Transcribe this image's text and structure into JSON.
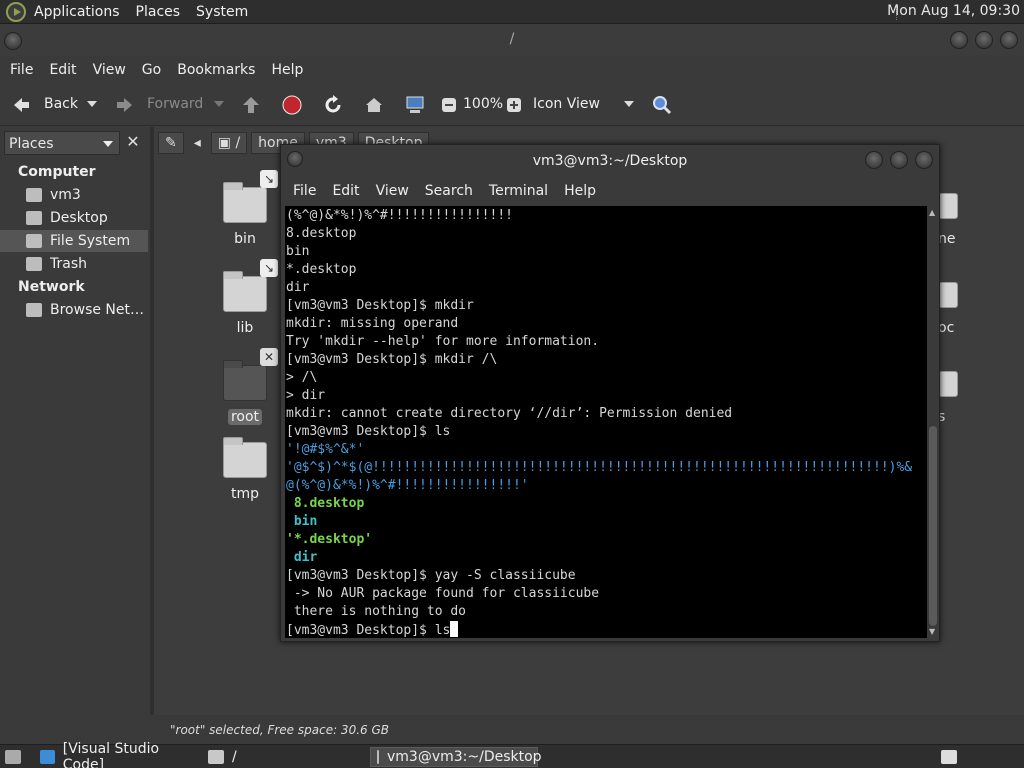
{
  "top_panel": {
    "menus": [
      "Applications",
      "Places",
      "System"
    ],
    "clock": "Mon Aug 14, 09:30"
  },
  "file_manager": {
    "title": "/",
    "menus": [
      "File",
      "Edit",
      "View",
      "Go",
      "Bookmarks",
      "Help"
    ],
    "toolbar": {
      "back": "Back",
      "forward": "Forward",
      "zoom": "100%",
      "view_mode": "Icon View"
    },
    "sidebar": {
      "selector": "Places",
      "sections": [
        {
          "title": "Computer",
          "items": [
            "vm3",
            "Desktop",
            "File System",
            "Trash"
          ]
        },
        {
          "title": "Network",
          "items": [
            "Browse Net…"
          ]
        }
      ],
      "selected": "File System"
    },
    "pathbar": [
      "/",
      "home",
      "vm3",
      "Desktop"
    ],
    "folders": [
      {
        "name": "bin",
        "emblem": "link"
      },
      {
        "name": "lib",
        "emblem": "link"
      },
      {
        "name": "root",
        "emblem": "locked",
        "selected": true
      },
      {
        "name": "tmp",
        "emblem": ""
      }
    ],
    "partial_labels": [
      "ne",
      "oc",
      "s"
    ],
    "status": "\"root\" selected, Free space: 30.6 GB"
  },
  "terminal": {
    "title": "vm3@vm3:~/Desktop",
    "menus": [
      "File",
      "Edit",
      "View",
      "Search",
      "Terminal",
      "Help"
    ],
    "lines": [
      {
        "t": "(%^@)&*%!)%^#!!!!!!!!!!!!!!!!",
        "c": ""
      },
      {
        "t": "8.desktop",
        "c": ""
      },
      {
        "t": "bin",
        "c": ""
      },
      {
        "t": "*.desktop",
        "c": ""
      },
      {
        "t": "dir",
        "c": ""
      },
      {
        "t": "[vm3@vm3 Desktop]$ mkdir",
        "c": ""
      },
      {
        "t": "mkdir: missing operand",
        "c": ""
      },
      {
        "t": "Try 'mkdir --help' for more information.",
        "c": ""
      },
      {
        "t": "[vm3@vm3 Desktop]$ mkdir /\\",
        "c": ""
      },
      {
        "t": "> /\\",
        "c": ""
      },
      {
        "t": "> dir",
        "c": ""
      },
      {
        "t": "mkdir: cannot create directory ‘//dir’: Permission denied",
        "c": ""
      },
      {
        "t": "[vm3@vm3 Desktop]$ ls",
        "c": ""
      },
      {
        "t": "'!@#$%^&*'",
        "c": "t-blue"
      },
      {
        "t": "'@$^$)^*$(@!!!!!!!!!!!!!!!!!!!!!!!!!!!!!!!!!!!!!!!!!!!!!!!!!!!!!!!!!!!!!!!!!!)%&",
        "c": "t-blue"
      },
      {
        "t": "@(%^@)&*%!)%^#!!!!!!!!!!!!!!!!'",
        "c": "t-blue"
      },
      {
        "t": " 8.desktop",
        "c": "t-green"
      },
      {
        "t": " bin",
        "c": "t-cyan"
      },
      {
        "t": "'*.desktop'",
        "c": "t-green"
      },
      {
        "t": " dir",
        "c": "t-cyan"
      },
      {
        "t": "[vm3@vm3 Desktop]$ yay -S classiicube",
        "c": ""
      },
      {
        "t": " -> No AUR package found for classiicube",
        "c": ""
      },
      {
        "t": " there is nothing to do",
        "c": ""
      }
    ],
    "prompt": "[vm3@vm3 Desktop]$ ls"
  },
  "taskbar": {
    "tasks": [
      "[Visual Studio Code]",
      "/",
      "vm3@vm3:~/Desktop"
    ]
  }
}
